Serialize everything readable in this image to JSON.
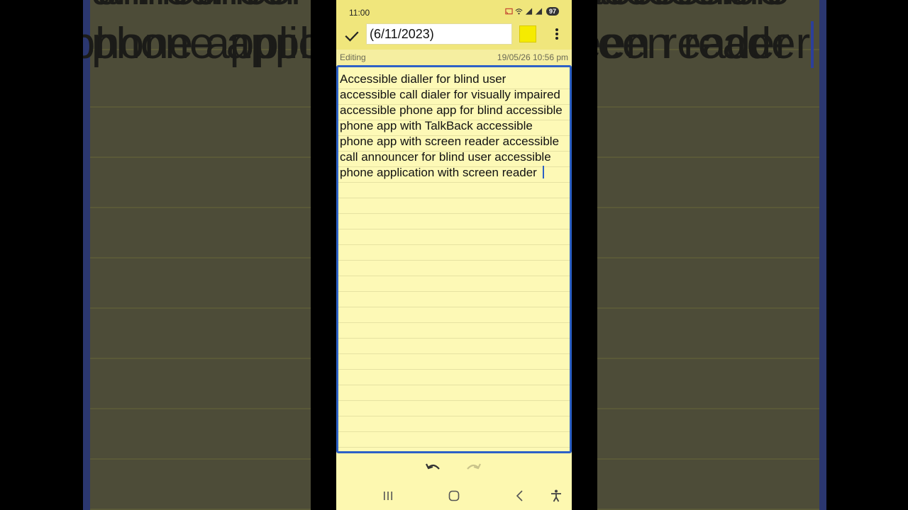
{
  "background_copy": {
    "line1": "announcer for blind user accessible",
    "line2": "phone application with screen reader"
  },
  "status_bar": {
    "time": "11:00",
    "battery": "97",
    "icons": [
      "cast-icon",
      "wifi-icon",
      "signal-icon",
      "signal-icon"
    ]
  },
  "toolbar": {
    "save_icon": "check-icon",
    "title_value": "(6/11/2023)",
    "color": "#f5eb00",
    "menu_icon": "more-vert-icon"
  },
  "info_bar": {
    "mode": "Editing",
    "timestamp": "19/05/26 10:56 pm"
  },
  "editor": {
    "text": "Accessible dialler for blind user accessible call dialer for visually impaired accessible phone app for blind accessible phone app with TalkBack accessible phone app with screen reader accessible call announcer for blind user accessible phone application with screen reader"
  },
  "bottom_actions": {
    "undo_icon": "undo-icon",
    "redo_icon": "redo-icon"
  },
  "nav_bar": {
    "recents_icon": "recents-icon",
    "home_icon": "home-icon",
    "back_icon": "back-icon",
    "accessibility_icon": "accessibility-icon"
  },
  "colors": {
    "note_yellow": "#fdf8b0",
    "toolbar_yellow": "#f0e67c",
    "focus_blue": "#2d61c6"
  }
}
